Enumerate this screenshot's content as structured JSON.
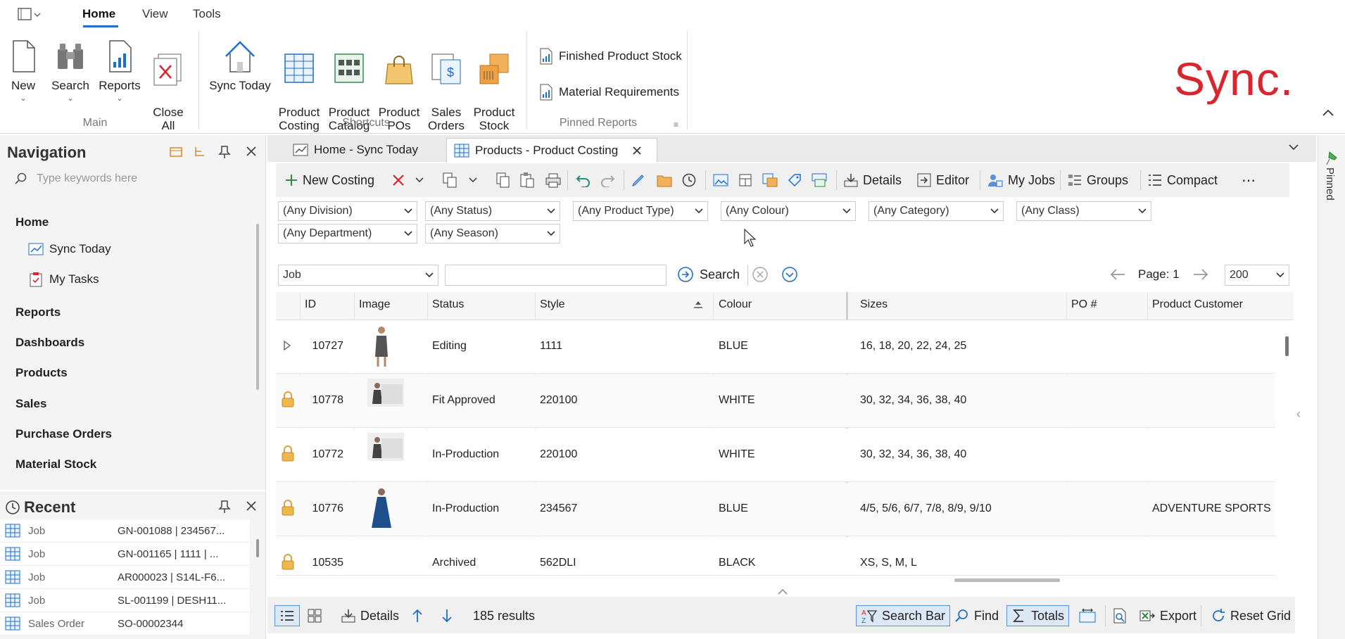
{
  "menubar": {
    "tabs": [
      "Home",
      "View",
      "Tools"
    ]
  },
  "ribbon": {
    "main": {
      "label": "Main",
      "buttons": [
        "New",
        "Search",
        "Reports",
        "Close\nAll"
      ]
    },
    "shortcuts": {
      "label": "Shortcuts",
      "buttons": [
        "Sync Today",
        "Product\nCosting",
        "Product\nCatalog",
        "Product\nPOs",
        "Sales\nOrders",
        "Product\nStock"
      ]
    },
    "pinned_reports": {
      "label": "Pinned Reports",
      "items": [
        "Finished Product Stock",
        "Material Requirements"
      ]
    },
    "logo": "Sync."
  },
  "navigation": {
    "title": "Navigation",
    "search_placeholder": "Type keywords here",
    "home": "Home",
    "home_items": [
      "Sync Today",
      "My Tasks"
    ],
    "sections": [
      "Reports",
      "Dashboards",
      "Products",
      "Sales",
      "Purchase Orders",
      "Material Stock"
    ]
  },
  "recent": {
    "title": "Recent",
    "items": [
      {
        "type": "Job",
        "value": "GN-001088 | 234567..."
      },
      {
        "type": "Job",
        "value": "GN-001165 | 1111 | ..."
      },
      {
        "type": "Job",
        "value": "AR000023 | S14L-F6..."
      },
      {
        "type": "Job",
        "value": "SL-001199 | DESH11..."
      },
      {
        "type": "Sales Order",
        "value": "SO-00002344"
      }
    ]
  },
  "doc_tabs": [
    "Home - Sync Today",
    "Products - Product Costing"
  ],
  "toolbar": {
    "new_costing": "New Costing",
    "details": "Details",
    "editor": "Editor",
    "my_jobs": "My Jobs",
    "groups": "Groups",
    "compact": "Compact"
  },
  "filters": [
    "(Any Division)",
    "(Any Status)",
    "(Any Product Type)",
    "(Any Colour)",
    "(Any Category)",
    "(Any Class)",
    "(Any Department)",
    "(Any Season)"
  ],
  "search": {
    "field": "Job",
    "value": "",
    "button": "Search",
    "page": "Page: 1",
    "page_size": "200"
  },
  "grid": {
    "columns": [
      "ID",
      "Image",
      "Status",
      "Style",
      "Colour",
      "Sizes",
      "PO #",
      "Product Customer"
    ],
    "rows": [
      {
        "id": "10727",
        "status": "Editing",
        "style": "1111",
        "colour": "BLUE",
        "sizes": "16, 18, 20, 22, 24, 25",
        "po": "",
        "customer": "",
        "locked": false
      },
      {
        "id": "10778",
        "status": "Fit Approved",
        "style": "220100",
        "colour": "WHITE",
        "sizes": "30, 32, 34, 36, 38, 40",
        "po": "",
        "customer": "",
        "locked": true
      },
      {
        "id": "10772",
        "status": "In-Production",
        "style": "220100",
        "colour": "WHITE",
        "sizes": "30, 32, 34, 36, 38, 40",
        "po": "",
        "customer": "",
        "locked": true
      },
      {
        "id": "10776",
        "status": "In-Production",
        "style": "234567",
        "colour": "BLUE",
        "sizes": "4/5, 5/6, 6/7, 7/8, 8/9, 9/10",
        "po": "",
        "customer": "ADVENTURE SPORTS",
        "locked": true
      },
      {
        "id": "10535",
        "status": "Archived",
        "style": "562DLI",
        "colour": "BLACK",
        "sizes": "XS, S, M, L",
        "po": "",
        "customer": "",
        "locked": true
      }
    ]
  },
  "statusbar": {
    "details": "Details",
    "results": "185 results",
    "search_bar": "Search Bar",
    "find": "Find",
    "totals": "Totals",
    "export": "Export",
    "reset_grid": "Reset Grid"
  },
  "side_pinned": "Pinned",
  "colors": {
    "accent": "#1e6fc7",
    "logo_red": "#d9262e",
    "lock": "#d9a43a"
  }
}
